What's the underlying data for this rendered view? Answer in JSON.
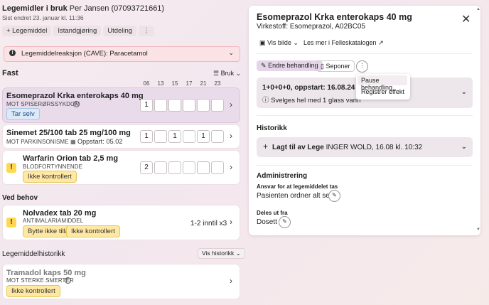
{
  "header": {
    "title": "Legemidler i bruk",
    "patient": "Per Jansen (07093721661)",
    "last_changed": "Sist endret 23. januar kl. 11:36",
    "actions": {
      "add": "+ Legemiddel",
      "standalone": "Istandgjøring",
      "dispense": "Utdeling",
      "more": "⋮"
    }
  },
  "alert": {
    "text": "Legemiddelreaksjon (CAVE): Paracetamol"
  },
  "fast": {
    "heading": "Fast",
    "use_label": "Bruk",
    "times": [
      "06",
      "13",
      "15",
      "17",
      "21",
      "23"
    ],
    "items": [
      {
        "name": "Esomeprazol Krka enterokaps 40 mg",
        "indication": "MOT SPISERØRSSYKDOM",
        "tag": "Tar selv",
        "doses": [
          "1",
          "",
          "",
          "",
          "",
          ""
        ]
      },
      {
        "name": "Sinemet 25/100 tab 25 mg/100 mg",
        "indication": "MOT PARKINSONISME",
        "start": "Oppstart: 05.02",
        "doses": [
          "1",
          "",
          "1",
          "",
          "1",
          ""
        ]
      },
      {
        "name": "Warfarin Orion tab 2,5 mg",
        "indication": "BLODFORTYNNENDE",
        "tag": "Ikke kontrollert",
        "doses": [
          "2",
          "",
          "",
          "",
          "",
          ""
        ]
      }
    ]
  },
  "ved_behov": {
    "heading": "Ved behov",
    "items": [
      {
        "name": "Nolvadex tab 20 mg",
        "indication": "ANTIMALARIAMIDDEL",
        "tags": [
          "Bytte ikke tillatt",
          "Ikke kontrollert"
        ],
        "dose": "1-2 inntil x3"
      }
    ]
  },
  "historikk_list": {
    "heading": "Legemiddelhistorikk",
    "button": "Vis historikk",
    "items": [
      {
        "name": "Tramadol kaps 50 mg",
        "indication": "MOT STERKE SMERTER",
        "tag": "Ikke kontrollert"
      }
    ]
  },
  "detail": {
    "title": "Esomeprazol Krka enterokaps 40 mg",
    "active": "Virkestoff: Esomeprazol, A02BC05",
    "show_image": "Vis bilde",
    "read_more": "Les mer i Felleskatalogen",
    "change_btn": "Endre behandling",
    "stop_btn": "Seponer",
    "menu": [
      "Pause behandling",
      "Registrer effekt"
    ],
    "dosing": "1+0+0+0, oppstart: 16.08.24",
    "instruction": "Svelges hel med 1 glass vann",
    "history_heading": "Historikk",
    "history_entry_bold": "Lagt til av Lege",
    "history_entry_rest": "INGER WOLD, 16.08 kl. 10:32",
    "admin_heading": "Administrering",
    "responsible_label": "Ansvar for at legemiddelet tas",
    "responsible_value": "Pasienten ordner alt selv",
    "dispensed_label": "Deles ut fra",
    "dispensed_value": "Dosett"
  },
  "colors": {
    "accent": "#e9d7ec",
    "alert_bg": "#fbe3e5",
    "warn": "#ffd84f"
  }
}
